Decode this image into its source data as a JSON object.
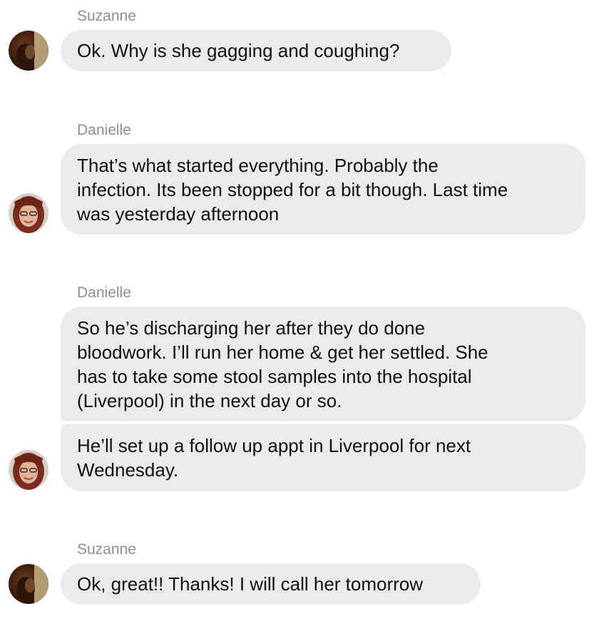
{
  "messages": [
    {
      "sender": "Suzanne",
      "bubbles": [
        "Ok. Why is she gagging and coughing?"
      ],
      "avatar": "suzanne-avatar"
    },
    {
      "sender": "Danielle",
      "bubbles": [
        "That’s what started everything. Probably the\ninfection. Its been stopped for a bit though. Last time\nwas yesterday afternoon"
      ],
      "avatar": "danielle-avatar"
    },
    {
      "sender": "Danielle",
      "bubbles": [
        "So he’s discharging her after they do done\nbloodwork. I’ll run her home & get her settled. She\nhas to take some  stool samples into the hospital\n(Liverpool) in the next day or so.",
        "He’ll set up a follow up appt in Liverpool for next\nWednesday."
      ],
      "avatar": "danielle-avatar"
    },
    {
      "sender": "Suzanne",
      "bubbles": [
        "Ok, great!! Thanks! I will call her tomorrow"
      ],
      "avatar": "suzanne-avatar"
    }
  ],
  "colors": {
    "bubble_bg": "#ebebeb",
    "sender_text": "#8e8e93",
    "message_text": "#111111"
  }
}
